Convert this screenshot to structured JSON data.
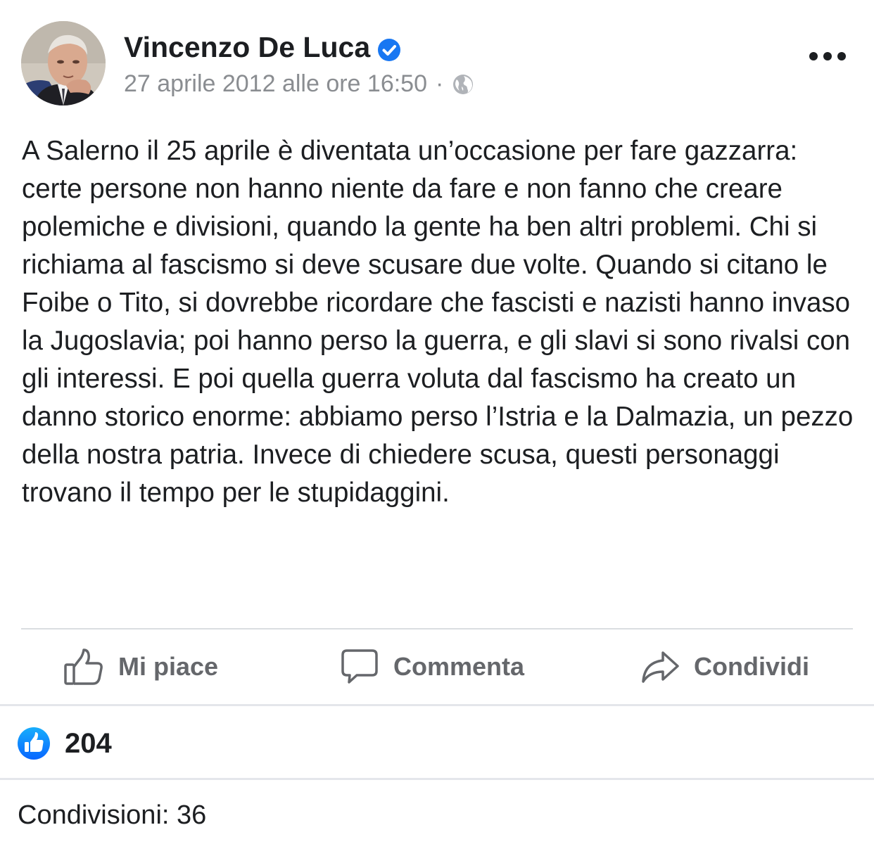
{
  "post": {
    "author": "Vincenzo De Luca",
    "timestamp": "27 aprile 2012 alle ore 16:50",
    "separator": "·",
    "icons": {
      "verified": "verified-badge-icon",
      "audience": "globe-icon",
      "more": "more-options-icon"
    },
    "text": "A Salerno il 25 aprile è diventata un’occasione per fare gazzarra: certe persone non hanno niente da fare e non fanno che creare polemiche e divisioni, quando la gente ha ben altri problemi. Chi si richiama al fascismo si deve scusare due volte. Quando si citano le Foibe o Tito, si dovrebbe ricordare che fascisti e nazisti hanno invaso la Jugoslavia; poi hanno perso la guerra, e gli slavi si sono rivalsi con gli interessi. E poi quella guerra voluta dal fascismo ha creato un danno storico enorme: abbiamo perso l’Istria e la Dalmazia, un pezzo della nostra patria. Invece di chiedere scusa, questi personaggi trovano il tempo per le stupidaggini."
  },
  "actions": {
    "like_label": "Mi piace",
    "comment_label": "Commenta",
    "share_label": "Condividi"
  },
  "stats": {
    "reaction_count": "204",
    "shares_text": "Condivisioni: 36"
  },
  "colors": {
    "brand_blue": "#1877f2",
    "meta_gray": "#8a8d91",
    "action_gray": "#65676b",
    "divider": "#dadde1"
  }
}
